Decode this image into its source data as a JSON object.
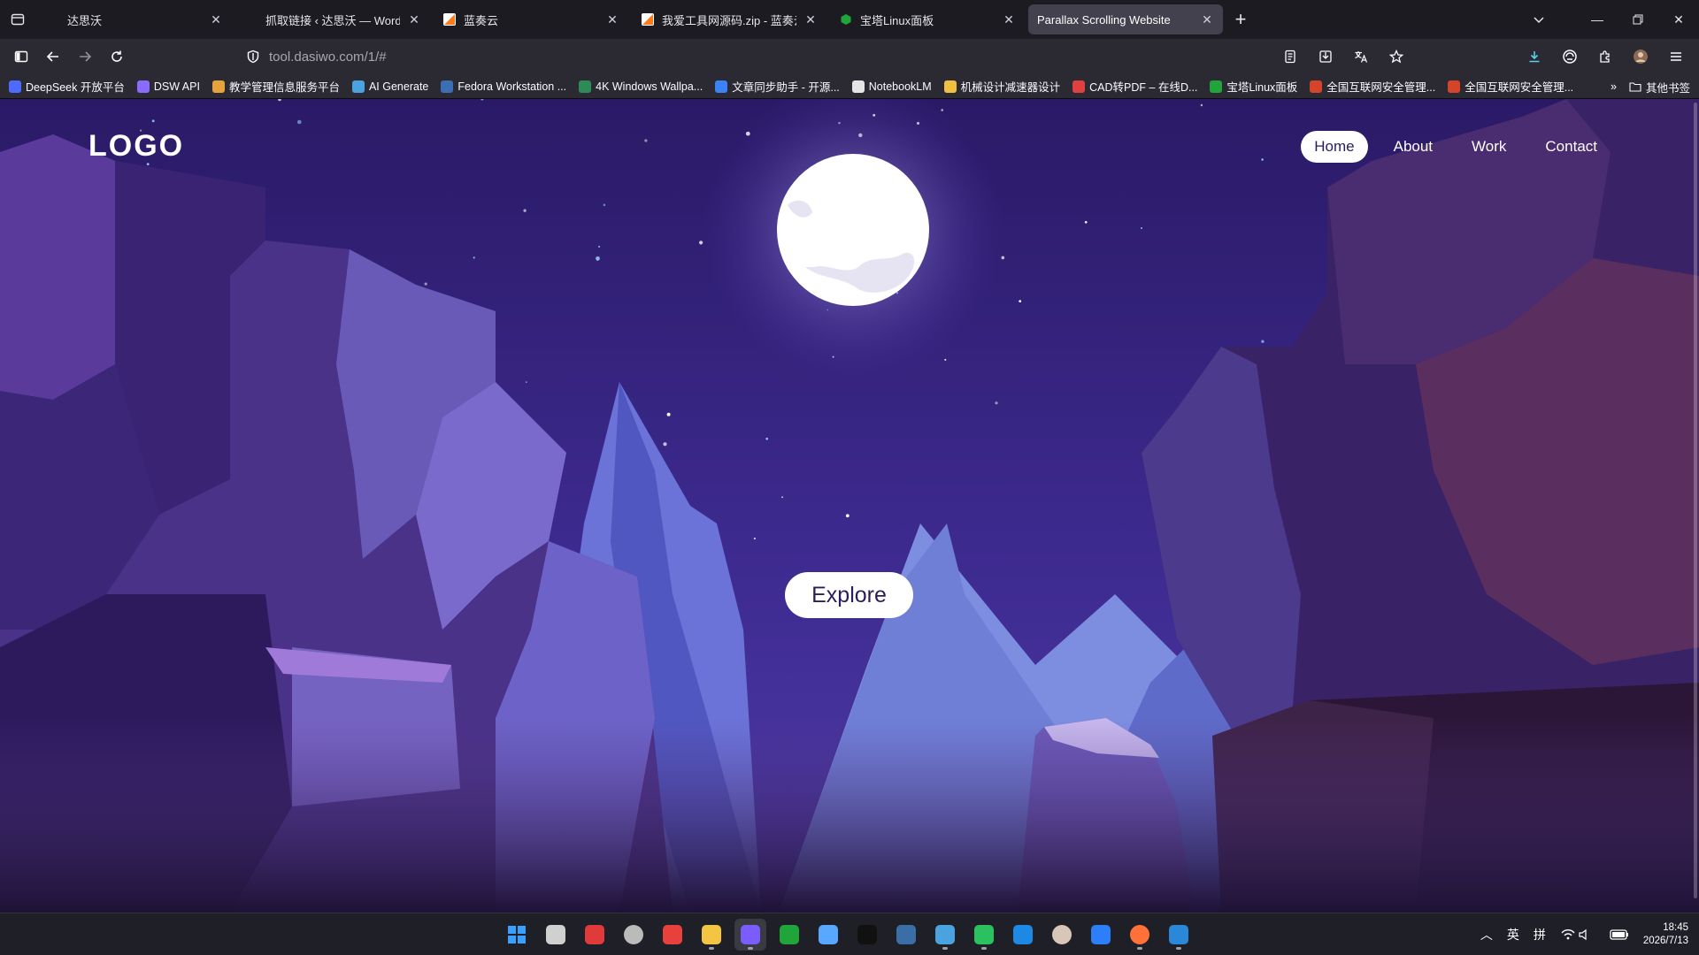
{
  "browser": {
    "tabs": [
      {
        "title": "达思沃",
        "favicon": "dasiwo-icon",
        "active": false
      },
      {
        "title": "抓取链接 ‹ 达思沃 — WordPress",
        "favicon": "wordpress-icon",
        "active": false
      },
      {
        "title": "蓝奏云",
        "favicon": "lanzou-icon",
        "active": false
      },
      {
        "title": "我爱工具网源码.zip - 蓝奏云",
        "favicon": "lanzou-icon",
        "active": false
      },
      {
        "title": "宝塔Linux面板",
        "favicon": "baota-icon",
        "active": false
      },
      {
        "title": "Parallax Scrolling Website",
        "favicon": "",
        "active": true
      }
    ],
    "url": {
      "host": "tool.dasiwo.com",
      "path": "/1/#"
    },
    "bookmarks": [
      {
        "label": "DeepSeek 开放平台",
        "color": "#4d6bfe"
      },
      {
        "label": "DSW API",
        "color": "#8a6bff"
      },
      {
        "label": "教学管理信息服务平台",
        "color": "#e6a23c"
      },
      {
        "label": "AI Generate",
        "color": "#4aa3df"
      },
      {
        "label": "Fedora Workstation ...",
        "color": "#3c6eb4"
      },
      {
        "label": "4K Windows Wallpa...",
        "color": "#2e8b57"
      },
      {
        "label": "文章同步助手 - 开源...",
        "color": "#3b82f6"
      },
      {
        "label": "NotebookLM",
        "color": "#e5e5e5"
      },
      {
        "label": "机械设计减速器设计",
        "color": "#f0c040"
      },
      {
        "label": "CAD转PDF – 在线D...",
        "color": "#e04040"
      },
      {
        "label": "宝塔Linux面板",
        "color": "#20a53a"
      },
      {
        "label": "全国互联网安全管理...",
        "color": "#d4442a"
      },
      {
        "label": "全国互联网安全管理...",
        "color": "#d4442a"
      }
    ],
    "other_bookmarks": "其他书签"
  },
  "site": {
    "logo": "LOGO",
    "nav": [
      {
        "label": "Home",
        "active": true
      },
      {
        "label": "About",
        "active": false
      },
      {
        "label": "Work",
        "active": false
      },
      {
        "label": "Contact",
        "active": false
      }
    ],
    "cta": "Explore"
  },
  "taskbar": {
    "apps": [
      {
        "name": "start-icon",
        "color": "#3aa0ff"
      },
      {
        "name": "task-view-icon",
        "color": "#d0d0d0"
      },
      {
        "name": "app-red-icon",
        "color": "#e03a3a"
      },
      {
        "name": "app-circle-icon",
        "color": "#bbbbbb"
      },
      {
        "name": "app-z-icon",
        "color": "#e8403a"
      },
      {
        "name": "file-explorer-icon",
        "color": "#f4c542"
      },
      {
        "name": "app-purple-icon",
        "color": "#7a5cff"
      },
      {
        "name": "baota-icon",
        "color": "#20a53a"
      },
      {
        "name": "app-network-icon",
        "color": "#5aa7ff"
      },
      {
        "name": "tiktok-icon",
        "color": "#111111"
      },
      {
        "name": "wordpress-icon",
        "color": "#3b6ea5"
      },
      {
        "name": "app-blue-icon",
        "color": "#4aa3df"
      },
      {
        "name": "wechat-icon",
        "color": "#2ac15e"
      },
      {
        "name": "app-orange-icon",
        "color": "#1e88e5"
      },
      {
        "name": "avatar-icon",
        "color": "#d8c6b8"
      },
      {
        "name": "app-cloud-icon",
        "color": "#2d7ff9"
      },
      {
        "name": "firefox-icon",
        "color": "#ff7139"
      },
      {
        "name": "app-chart-icon",
        "color": "#2b88d8"
      }
    ],
    "ime_lang": "英",
    "ime_mode": "拼",
    "time": "18:45",
    "date": "2026/7/13"
  }
}
